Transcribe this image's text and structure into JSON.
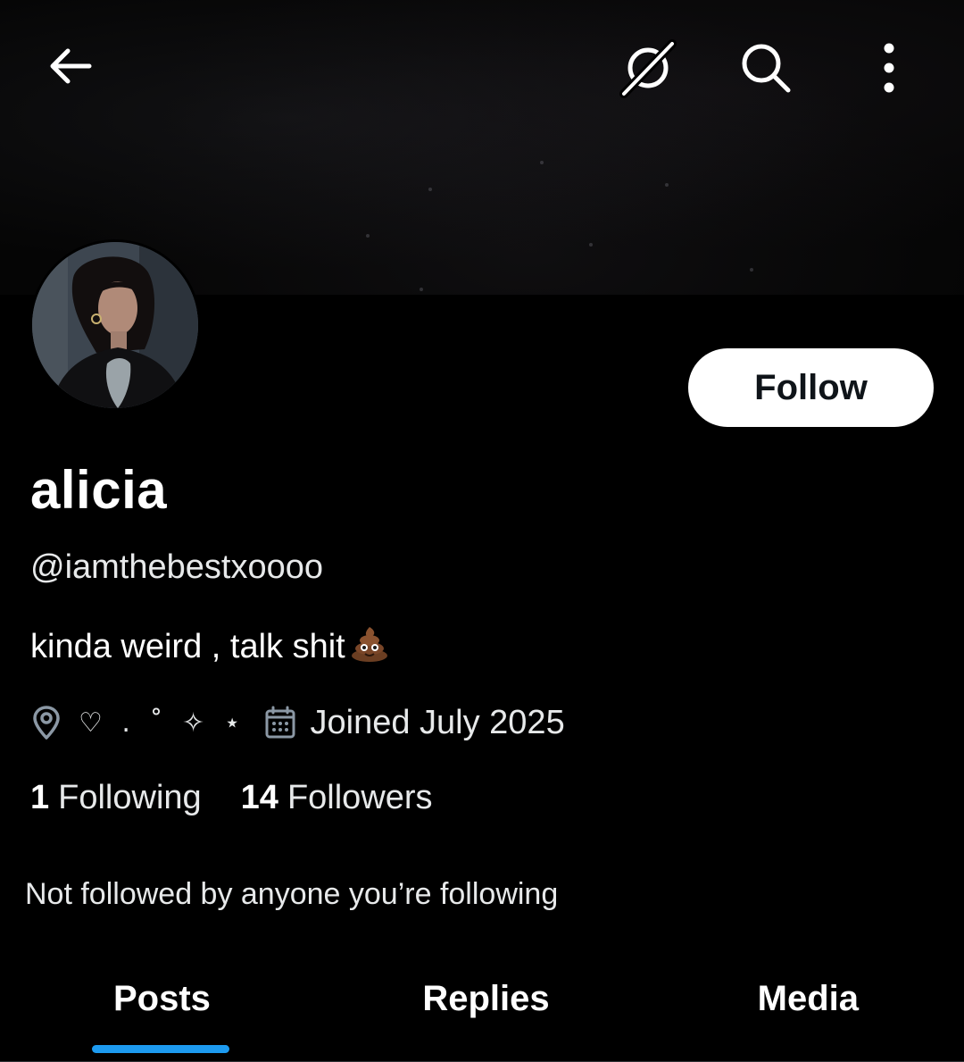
{
  "header": {
    "back_icon": "arrow-left-icon",
    "grok_icon": "grok-icon",
    "search_icon": "search-icon",
    "more_icon": "more-vertical-icon"
  },
  "profile": {
    "display_name": "alicia",
    "handle": "@iamthebestxoooo",
    "bio_text": "kinda weird , talk shit",
    "bio_emoji": "💩",
    "location": "♡ . ˚ ✧ ⋆",
    "joined": "Joined July 2025",
    "following_count": "1",
    "following_label": "Following",
    "followers_count": "14",
    "followers_label": "Followers",
    "followed_by_text": "Not followed by anyone you’re following"
  },
  "actions": {
    "follow_label": "Follow"
  },
  "tabs": [
    {
      "label": "Posts",
      "selected": true
    },
    {
      "label": "Replies",
      "selected": false
    },
    {
      "label": "Media",
      "selected": false
    }
  ],
  "colors": {
    "background": "#000000",
    "accent": "#1d9bf0",
    "follow_button_bg": "#ffffff",
    "follow_button_text": "#0f1419"
  }
}
